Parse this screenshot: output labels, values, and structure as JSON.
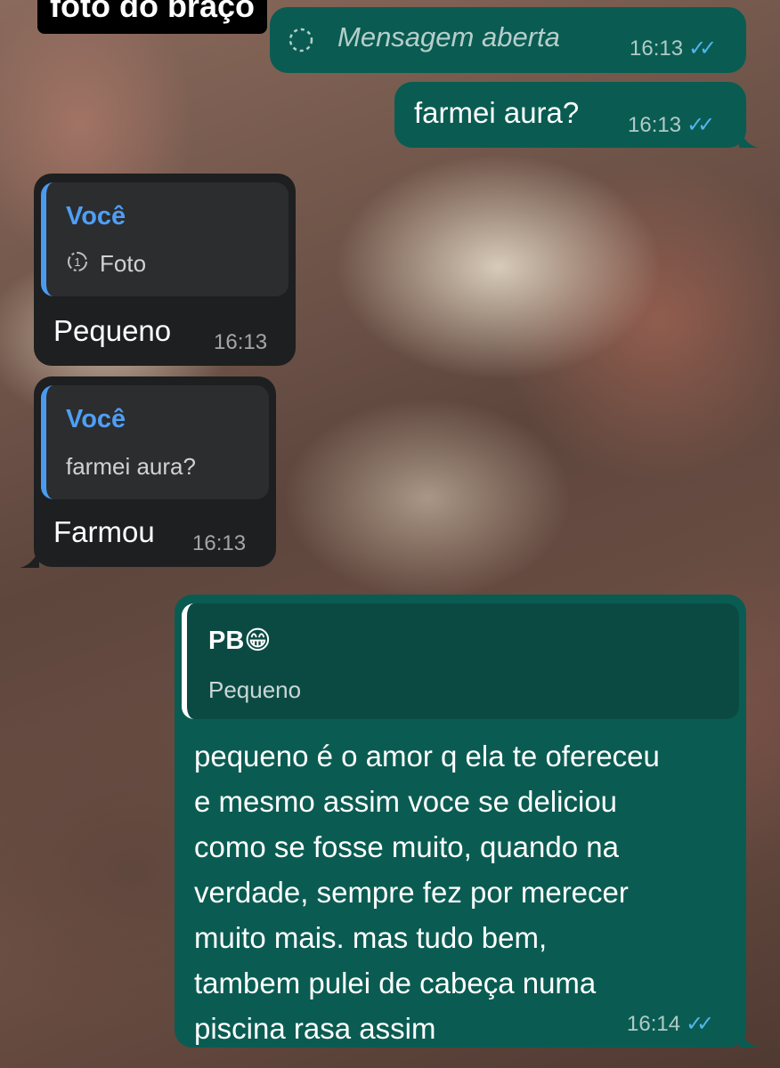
{
  "overlay_label": "foto do braço",
  "messages": [
    {
      "id": "m1",
      "direction": "outgoing",
      "icon": "view-once-opened-icon",
      "text": "Mensagem aberta",
      "time": "16:13",
      "status": "read"
    },
    {
      "id": "m2",
      "direction": "outgoing",
      "text": "farmei aura?",
      "time": "16:13",
      "status": "read"
    },
    {
      "id": "m3",
      "direction": "incoming",
      "quote": {
        "author": "Você",
        "icon": "view-once-icon",
        "text": "Foto"
      },
      "text": "Pequeno",
      "time": "16:13"
    },
    {
      "id": "m4",
      "direction": "incoming",
      "quote": {
        "author": "Você",
        "text": "farmei aura?"
      },
      "text": "Farmou",
      "time": "16:13"
    },
    {
      "id": "m5",
      "direction": "outgoing",
      "quote": {
        "author": "PB😁",
        "text": "Pequeno"
      },
      "lines": [
        "pequeno é o amor q ela te ofereceu",
        "e mesmo assim voce se deliciou",
        "como se fosse muito, quando na",
        "verdade, sempre fez por merecer",
        "muito mais. mas tudo bem,",
        "tambem pulei de cabeça numa",
        "piscina rasa assim"
      ],
      "time": "16:14",
      "status": "read"
    }
  ],
  "colors": {
    "outgoing_bubble": "#0a5c52",
    "incoming_bubble": "#1d1f20",
    "read_ticks": "#4fb6ec",
    "quote_author": "#4f9ef5"
  }
}
